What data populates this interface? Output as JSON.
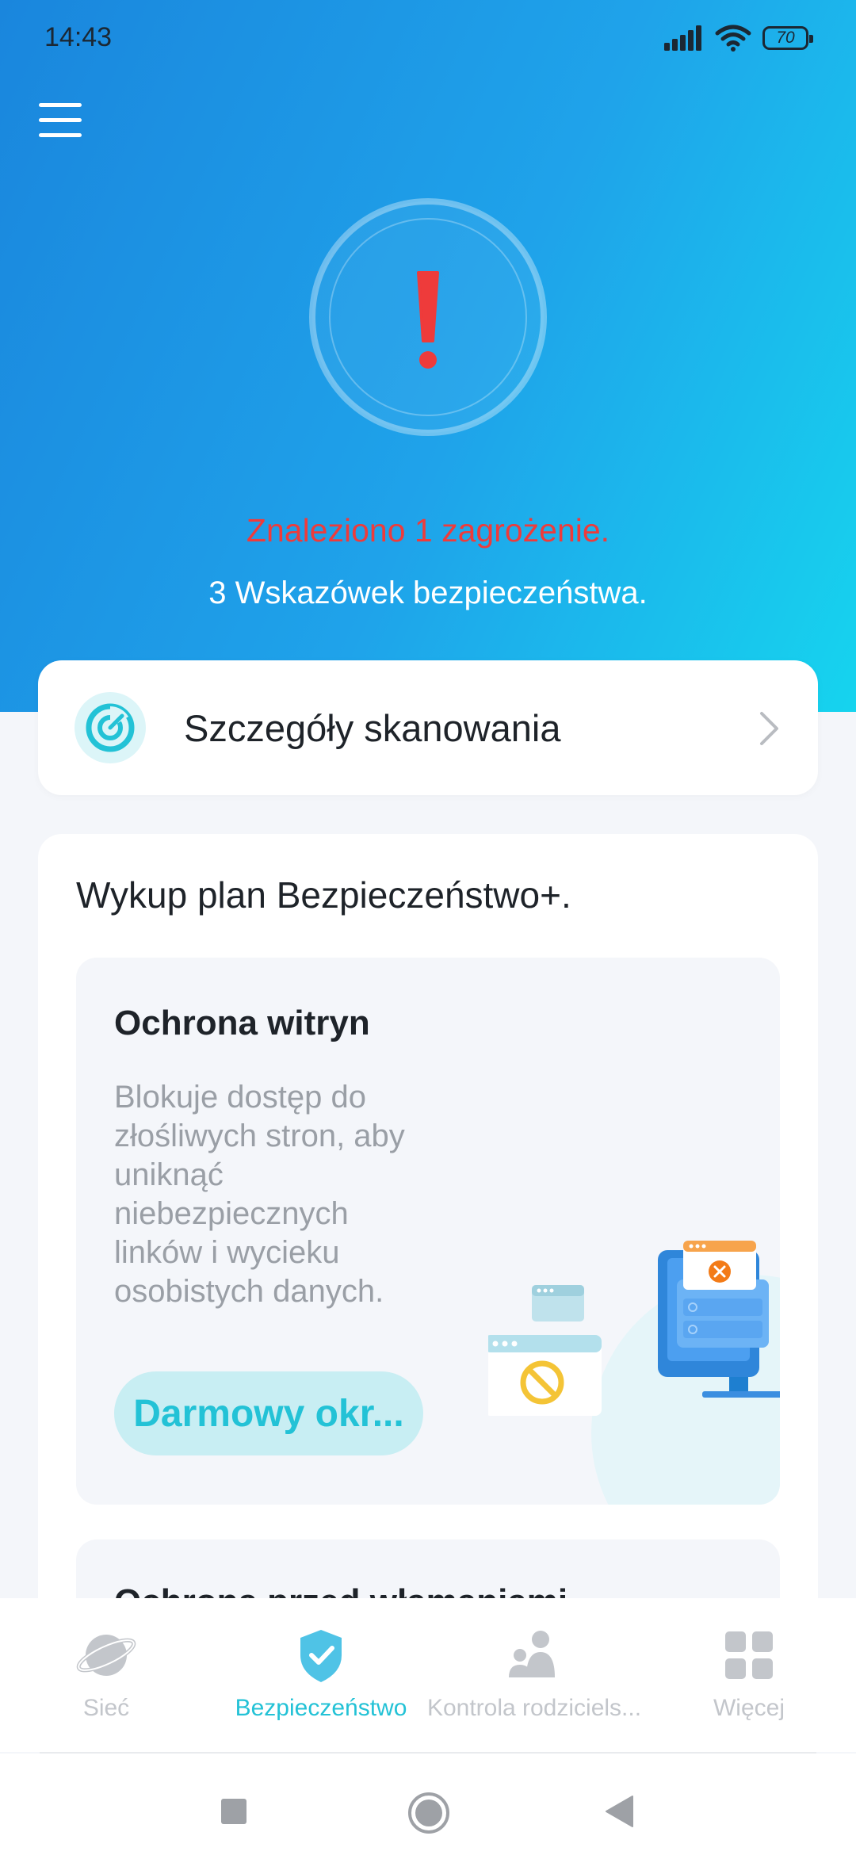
{
  "status_bar": {
    "time": "14:43",
    "battery": "70"
  },
  "header": {
    "threat_text": "Znaleziono 1 zagrożenie.",
    "tips_text": "3 Wskazówek bezpieczeństwa."
  },
  "scan_card": {
    "label": "Szczegóły skanowania"
  },
  "promo": {
    "title": "Wykup plan Bezpieczeństwo+.",
    "feature": {
      "title": "Ochrona witryn",
      "description": "Blokuje dostęp do złośliwych stron, aby uniknąć niebezpiecznych linków i wycieku osobistych danych.",
      "button_label": "Darmowy okr..."
    },
    "next_feature_title": "Ochrona przed włamaniami"
  },
  "bottom_nav": {
    "items": [
      {
        "label": "Sieć",
        "icon": "planet-icon",
        "active": false
      },
      {
        "label": "Bezpieczeństwo",
        "icon": "shield-check-icon",
        "active": true
      },
      {
        "label": "Kontrola rodziciels...",
        "icon": "family-icon",
        "active": false
      },
      {
        "label": "Więcej",
        "icon": "grid-icon",
        "active": false
      }
    ]
  },
  "colors": {
    "accent": "#23c2d6",
    "threat": "#ee3b3b",
    "hero_start": "#1a86dd",
    "hero_end": "#16d4ee"
  }
}
